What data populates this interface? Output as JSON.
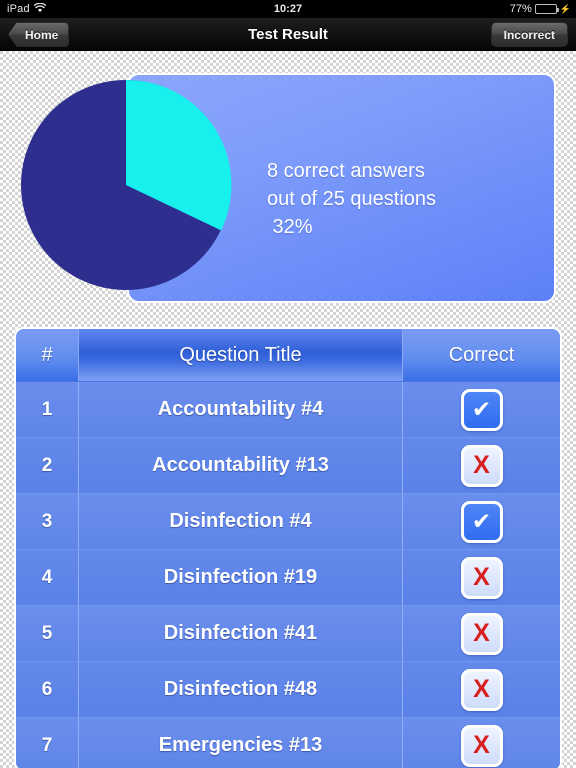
{
  "status_bar": {
    "device": "iPad",
    "wifi_icon": "wifi-icon",
    "time": "10:27",
    "battery_percent": "77%",
    "battery_icon": "battery-icon",
    "charging_icon": "lightning-bolt-icon"
  },
  "nav_bar": {
    "back_label": "Home",
    "title": "Test Result",
    "right_label": "Incorrect"
  },
  "summary": {
    "line1": "8 correct answers",
    "line2": "out of 25 questions",
    "line3": " 32%",
    "correct_count": 8,
    "total_questions": 25,
    "percent": "32%"
  },
  "chart_data": {
    "type": "pie",
    "title": "Test Result",
    "categories": [
      "Correct",
      "Incorrect"
    ],
    "values": [
      8,
      17
    ],
    "percentages": [
      32,
      68
    ],
    "colors": [
      "#18f0ee",
      "#2e2e8f"
    ],
    "start_angle_deg": 0,
    "direction": "clockwise",
    "legend": "none",
    "annotations": [
      "8 correct answers",
      "out of 25 questions",
      " 32%"
    ]
  },
  "table": {
    "columns": [
      "#",
      "Question Title",
      "Correct"
    ],
    "rows": [
      {
        "num": "1",
        "title": "Accountability #4",
        "correct": true,
        "mark": "check-icon"
      },
      {
        "num": "2",
        "title": "Accountability #13",
        "correct": false,
        "mark": "x-icon"
      },
      {
        "num": "3",
        "title": "Disinfection #4",
        "correct": true,
        "mark": "check-icon"
      },
      {
        "num": "4",
        "title": "Disinfection #19",
        "correct": false,
        "mark": "x-icon"
      },
      {
        "num": "5",
        "title": "Disinfection #41",
        "correct": false,
        "mark": "x-icon"
      },
      {
        "num": "6",
        "title": "Disinfection #48",
        "correct": false,
        "mark": "x-icon"
      },
      {
        "num": "7",
        "title": "Emergencies #13",
        "correct": false,
        "mark": "x-icon"
      }
    ],
    "check_glyph": "✔",
    "x_glyph": "X"
  },
  "colors": {
    "accent": "#5d80f7",
    "pie_correct": "#18f0ee",
    "pie_incorrect": "#2e2e8f",
    "wrong_red": "#d81f1f",
    "battery_green": "#4cd856"
  }
}
